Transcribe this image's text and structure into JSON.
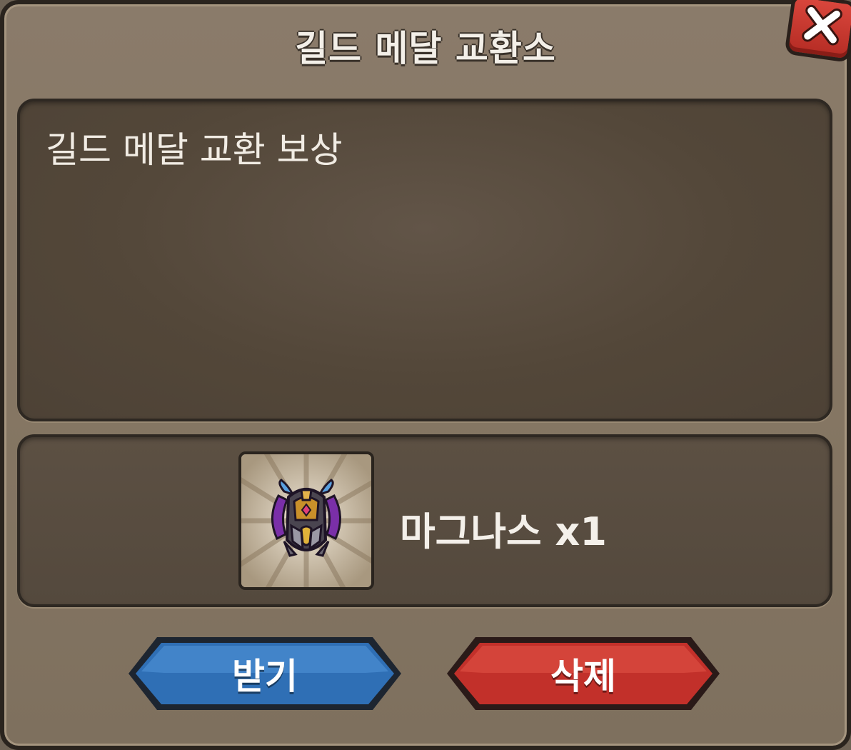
{
  "dialog": {
    "title": "길드 메달 교환소",
    "close_icon": "close-x-icon"
  },
  "message": {
    "text": "길드 메달 교환 보상"
  },
  "reward": {
    "item_icon": "magnus-helmet-icon",
    "item_label": "마그나스 x1"
  },
  "buttons": {
    "receive_label": "받기",
    "delete_label": "삭제"
  },
  "colors": {
    "receive_button": "#2f6fb5",
    "delete_button": "#c2302a",
    "close_button": "#c9362e"
  }
}
